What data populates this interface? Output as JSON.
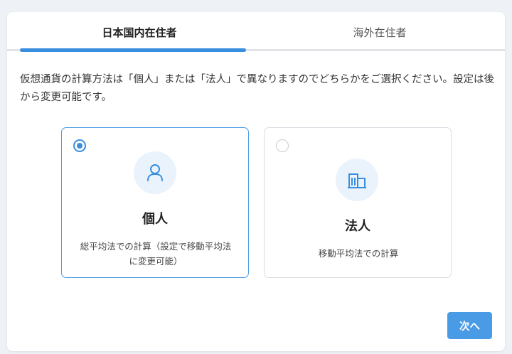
{
  "tabs": [
    {
      "label": "日本国内在住者",
      "active": true
    },
    {
      "label": "海外在住者",
      "active": false
    }
  ],
  "description": "仮想通貨の計算方法は「個人」または「法人」で異なりますのでどちらかをご選択ください。設定は後から変更可能です。",
  "options": [
    {
      "title": "個人",
      "description": "総平均法での計算（設定で移動平均法に変更可能）",
      "selected": true,
      "icon": "person-icon"
    },
    {
      "title": "法人",
      "description": "移動平均法での計算",
      "selected": false,
      "icon": "building-icon"
    }
  ],
  "next_button": "次へ",
  "colors": {
    "accent": "#3a8ee0",
    "button": "#4a9be6",
    "icon_bg": "#eaf3fc",
    "page_bg": "#eef1f6"
  }
}
